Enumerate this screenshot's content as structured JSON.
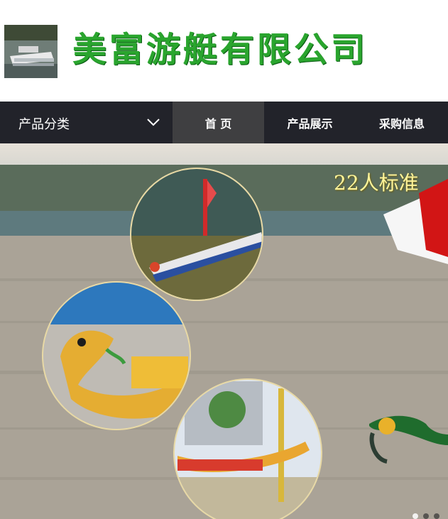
{
  "header": {
    "brand_name": "美富游艇有限公司"
  },
  "nav": {
    "category_label": "产品分类",
    "items": [
      {
        "label": "首 页",
        "active": true
      },
      {
        "label": "产品展示",
        "active": false
      },
      {
        "label": "采购信息",
        "active": false
      }
    ]
  },
  "hero": {
    "promo_text": "22人标准"
  },
  "colors": {
    "nav_bg": "#22232a",
    "nav_active_bg": "#3f3f41",
    "brand_green": "#2aa52e"
  },
  "icons": {
    "dropdown": "chevron-down-icon",
    "logo": "pontoon-boat-photo"
  }
}
